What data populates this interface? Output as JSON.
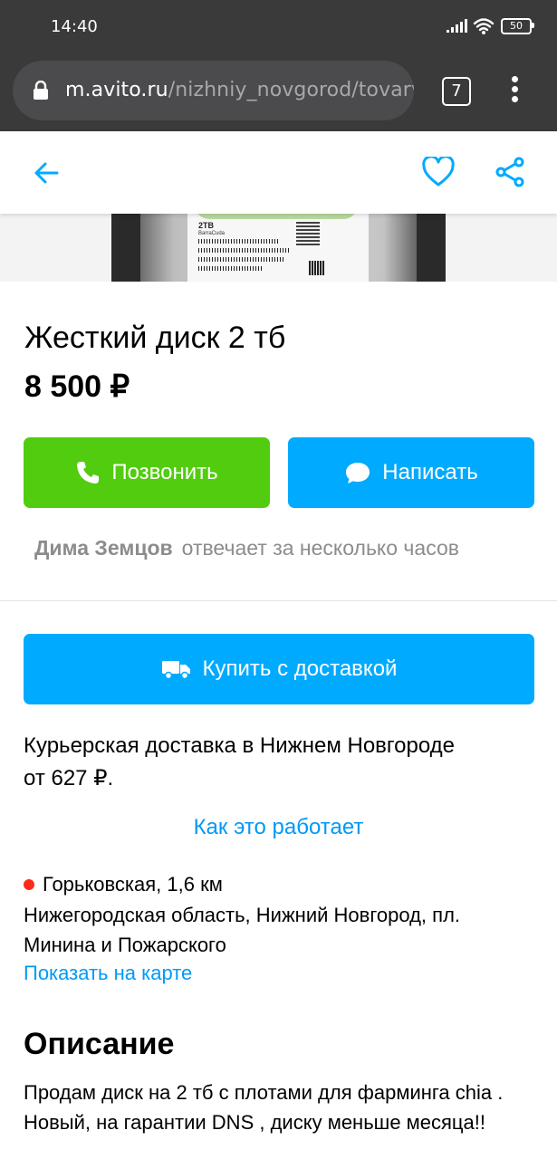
{
  "status_bar": {
    "time": "14:40",
    "battery": "50",
    "icons": [
      "signal-icon",
      "wifi-icon",
      "battery-icon"
    ]
  },
  "browser": {
    "url_host": "m.avito.ru",
    "url_path": "/nizhniy_novgorod/tovary_",
    "tab_count": "7",
    "icons": [
      "lock-icon",
      "tabs-icon",
      "more-vertical-icon"
    ]
  },
  "top_nav": {
    "icons": [
      "arrow-back-icon",
      "heart-icon",
      "share-icon"
    ],
    "accent_color": "#00aaff"
  },
  "listing": {
    "photo": {
      "capacity": "2TB",
      "model": "BarraCuda"
    },
    "title": "Жесткий диск 2 тб",
    "price": "8 500 ₽",
    "call_button": "Позвонить",
    "message_button": "Написать",
    "seller_name": "Дима Земцов",
    "seller_response": "отвечает за несколько часов",
    "buy_button": "Купить с доставкой",
    "delivery_line1": "Курьерская доставка в Нижнем Новгороде",
    "delivery_line2": "от 627 ₽.",
    "how_it_works": "Как это работает",
    "metro_station": "Горьковская, 1,6 км",
    "address": "Нижегородская область, Нижний Новгород, пл. Минина и Пожарского",
    "show_on_map": "Показать на карте",
    "description_heading": "Описание",
    "description_text": "Продам диск на 2 тб с плотами для фарминга chia . Новый, на гарантии DNS , диску меньше месяца!!"
  },
  "colors": {
    "call_green": "#52cc0f",
    "primary_blue": "#00aaff",
    "link_blue": "#0099f7",
    "metro_red": "#ff2a1b",
    "browser_dark": "#3a3a3b"
  }
}
